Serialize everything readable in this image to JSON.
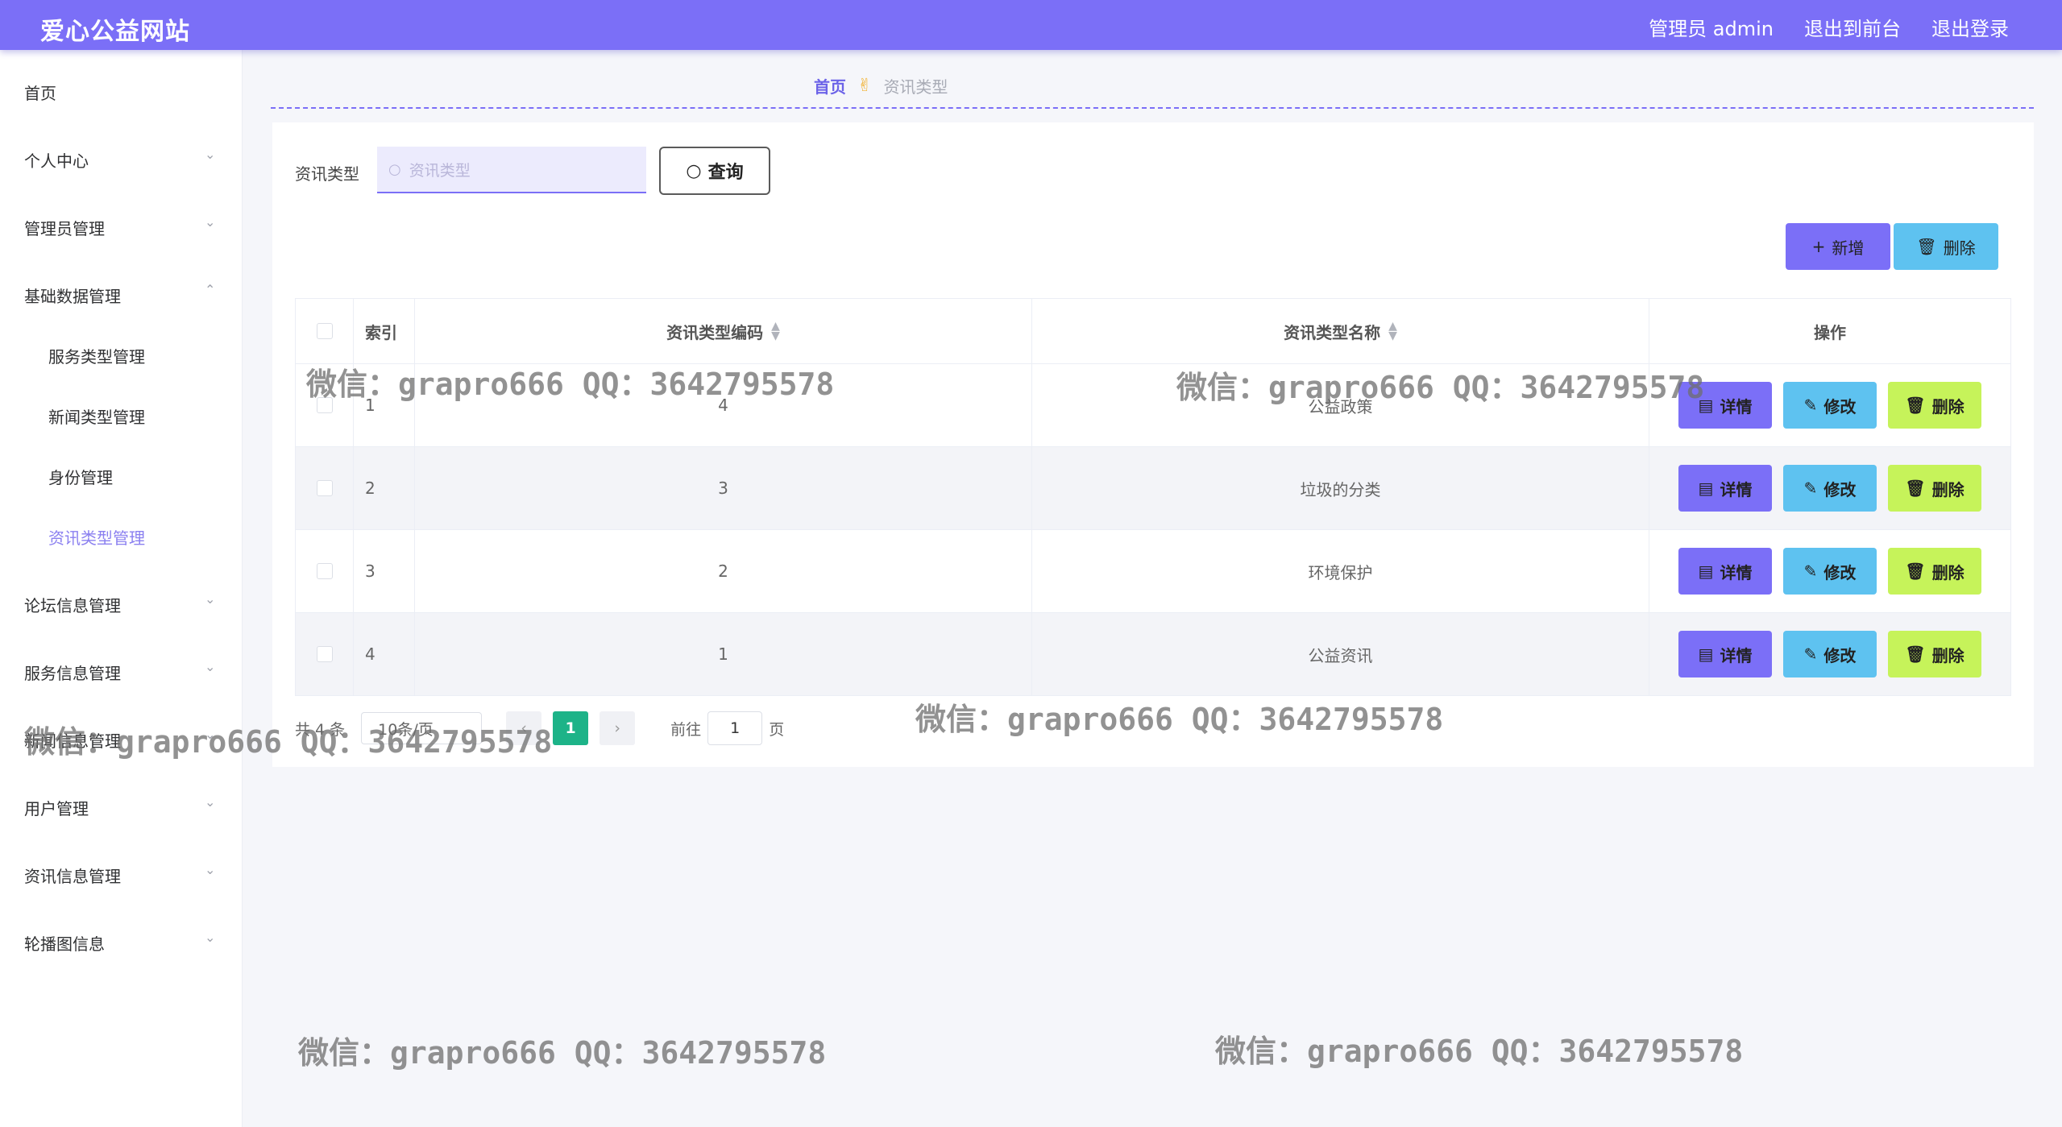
{
  "header": {
    "site_title": "爱心公益网站",
    "links": [
      "管理员 admin",
      "退出到前台",
      "退出登录"
    ]
  },
  "sidebar": {
    "items": [
      {
        "label": "首页",
        "arrow": ""
      },
      {
        "label": "个人中心",
        "arrow": "⌄"
      },
      {
        "label": "管理员管理",
        "arrow": "⌄"
      },
      {
        "label": "基础数据管理",
        "arrow": "⌃"
      },
      {
        "label": "服务类型管理",
        "arrow": ""
      },
      {
        "label": "新闻类型管理",
        "arrow": ""
      },
      {
        "label": "身份管理",
        "arrow": ""
      },
      {
        "label": "资讯类型管理",
        "arrow": ""
      },
      {
        "label": "论坛信息管理",
        "arrow": "⌄"
      },
      {
        "label": "服务信息管理",
        "arrow": "⌄"
      },
      {
        "label": "新闻信息管理",
        "arrow": "⌄"
      },
      {
        "label": "用户管理",
        "arrow": "⌄"
      },
      {
        "label": "资讯信息管理",
        "arrow": "⌄"
      },
      {
        "label": "轮播图信息",
        "arrow": "⌄"
      }
    ]
  },
  "breadcrumb": {
    "home": "首页",
    "separator": "✌",
    "current": "资讯类型"
  },
  "search": {
    "label": "资讯类型",
    "placeholder": "资讯类型",
    "query_label": "查询"
  },
  "toolbar": {
    "add_label": "新增",
    "delete_label": "删除"
  },
  "table": {
    "columns": [
      "索引",
      "资讯类型编码",
      "资讯类型名称",
      "操作"
    ],
    "rows": [
      {
        "index": "1",
        "code": "4",
        "name": "公益政策"
      },
      {
        "index": "2",
        "code": "3",
        "name": "垃圾的分类"
      },
      {
        "index": "3",
        "code": "2",
        "name": "环境保护"
      },
      {
        "index": "4",
        "code": "1",
        "name": "公益资讯"
      }
    ],
    "actions": {
      "detail": "详情",
      "edit": "修改",
      "delete": "删除"
    }
  },
  "pagination": {
    "total": "共 4 条",
    "page_size": "10条/页",
    "current_page": "1",
    "goto_label": "前往",
    "goto_value": "1",
    "page_suffix": "页"
  },
  "watermark": "微信：grapro666 QQ：3642795578",
  "colors": {
    "accent": "#7b6ff7",
    "info": "#5ec2f0",
    "lime": "#c6f35a",
    "page_active": "#1db388"
  }
}
